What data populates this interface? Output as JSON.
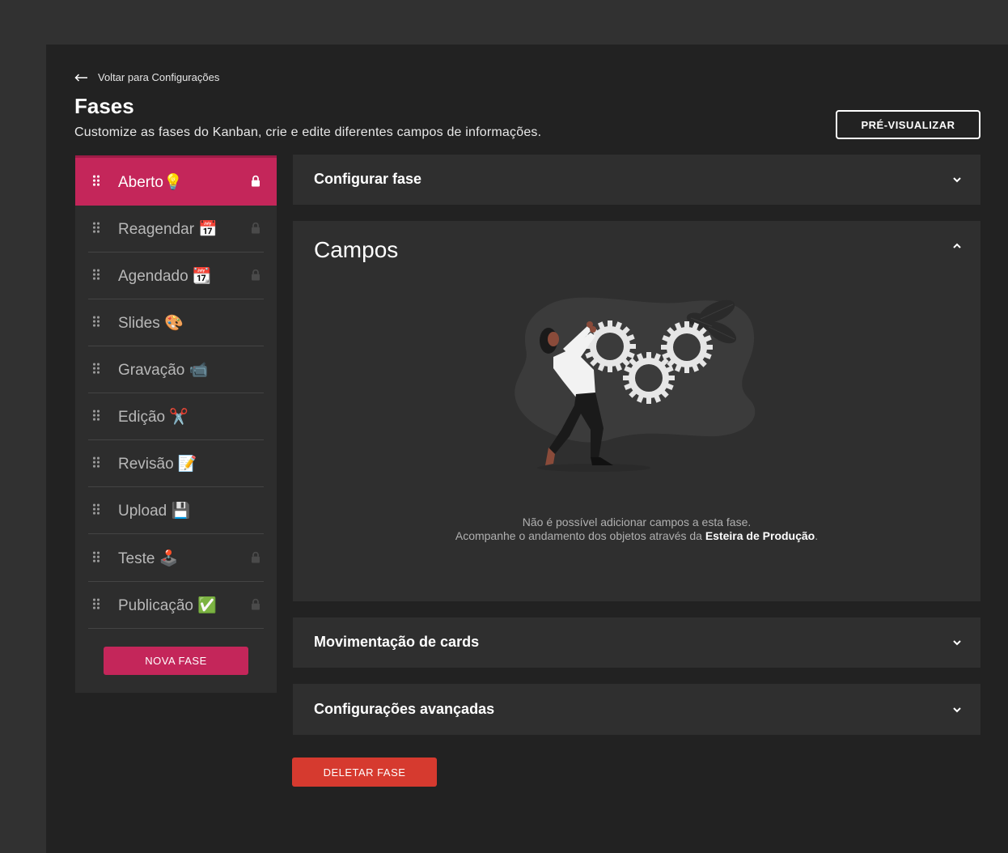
{
  "header": {
    "back_label": "Voltar para Configurações",
    "title": "Fases",
    "subtitle": "Customize as fases do Kanban, crie e edite diferentes campos de informações.",
    "preview_label": "PRÉ-VISUALIZAR"
  },
  "phases": [
    {
      "label": "Aberto💡",
      "locked": true,
      "active": true
    },
    {
      "label": "Reagendar 📅",
      "locked": true
    },
    {
      "label": "Agendado 📆",
      "locked": true
    },
    {
      "label": "Slides 🎨",
      "locked": false
    },
    {
      "label": "Gravação 📹",
      "locked": false
    },
    {
      "label": "Edição ✂️",
      "locked": false
    },
    {
      "label": "Revisão 📝",
      "locked": false
    },
    {
      "label": "Upload 💾",
      "locked": false
    },
    {
      "label": "Teste 🕹️",
      "locked": true
    },
    {
      "label": "Publicação ✅",
      "locked": true
    }
  ],
  "new_phase_label": "NOVA FASE",
  "sections": {
    "configure": "Configurar fase",
    "fields": "Campos",
    "movement": "Movimentação de cards",
    "advanced": "Configurações avançadas"
  },
  "empty_state": {
    "line1": "Não é possível adicionar campos a esta fase.",
    "line2_prefix": "Acompanhe o andamento dos objetos através da ",
    "line2_link": "Esteira de Produção",
    "line2_suffix": "."
  },
  "delete_label": "DELETAR FASE",
  "colors": {
    "accent": "#c4265a",
    "danger": "#d63a2f",
    "background": "#222222",
    "panel": "#2f2f2f"
  }
}
